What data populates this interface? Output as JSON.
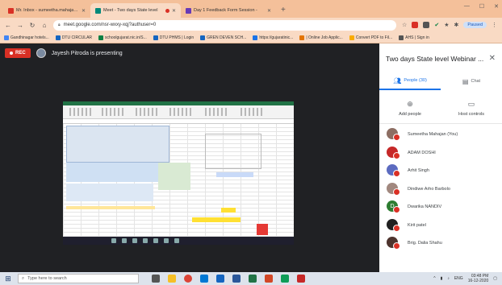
{
  "browser": {
    "tabs": [
      {
        "label": "Mr. Inbox - sumeetha.mahajan@gujb...",
        "favicon_color": "#d93025",
        "recording": false
      },
      {
        "label": "Meet - Two days State level",
        "favicon_color": "#00897b",
        "recording": true
      },
      {
        "label": "Day 1 Feedback Form Session - ",
        "favicon_color": "#673ab7",
        "recording": false
      }
    ],
    "new_tab": "+",
    "url": "meet.google.com/nsr-wxxy-xqj?authuser=0",
    "profile_status": "Paused",
    "bookmarks": [
      {
        "label": "Gandhinagar hotels...",
        "color": "#4285f4"
      },
      {
        "label": "DTU CIRCULAR",
        "color": "#1565c0"
      },
      {
        "label": "schoolgujarat.nic.in/S...",
        "color": "#0b8043"
      },
      {
        "label": "DTU PHMS | Login",
        "color": "#1565c0"
      },
      {
        "label": "GREN DEVEN SCH...",
        "color": "#1565c0"
      },
      {
        "label": "https://gujaratinic...",
        "color": "#1a73e8"
      },
      {
        "label": "| Online Job Applic...",
        "color": "#e37400"
      },
      {
        "label": "Convert PDF to Fil...",
        "color": "#f9ab00"
      },
      {
        "label": "AHS | Sign in",
        "color": "#555555"
      }
    ]
  },
  "meeting": {
    "rec_label": "REC",
    "presenter_text": "Jayesh Pitroda is presenting"
  },
  "panel": {
    "title": "Two days State level Webinar ...",
    "tabs": [
      {
        "label": "People (30)",
        "icon": "people-icon",
        "active": true
      },
      {
        "label": "Chat",
        "icon": "chat-icon",
        "active": false
      }
    ],
    "actions": [
      {
        "label": "Add people",
        "icon": "add-person-icon"
      },
      {
        "label": "Host controls",
        "icon": "host-controls-icon"
      }
    ],
    "participants": [
      {
        "name": "Sumeetha Mahajan (You)",
        "avatar_color": "#8d6e63"
      },
      {
        "name": "ADAM DOSHI",
        "avatar_color": "#c62828"
      },
      {
        "name": "Arhit Singh",
        "avatar_color": "#5c6bc0"
      },
      {
        "name": "Dindiwe Arho Barbolo",
        "avatar_color": "#a1887f"
      },
      {
        "name": "Dwarika NANDIV",
        "avatar_color": "#2e7d32",
        "initial": "D"
      },
      {
        "name": "Kirit patel",
        "avatar_color": "#212121"
      },
      {
        "name": "Brig. Dalia Shahu",
        "avatar_color": "#4e342e"
      }
    ]
  },
  "taskbar": {
    "search_placeholder": "Type here to search",
    "language": "ENG",
    "time": "03:48 PM",
    "date": "16-12-2020"
  }
}
